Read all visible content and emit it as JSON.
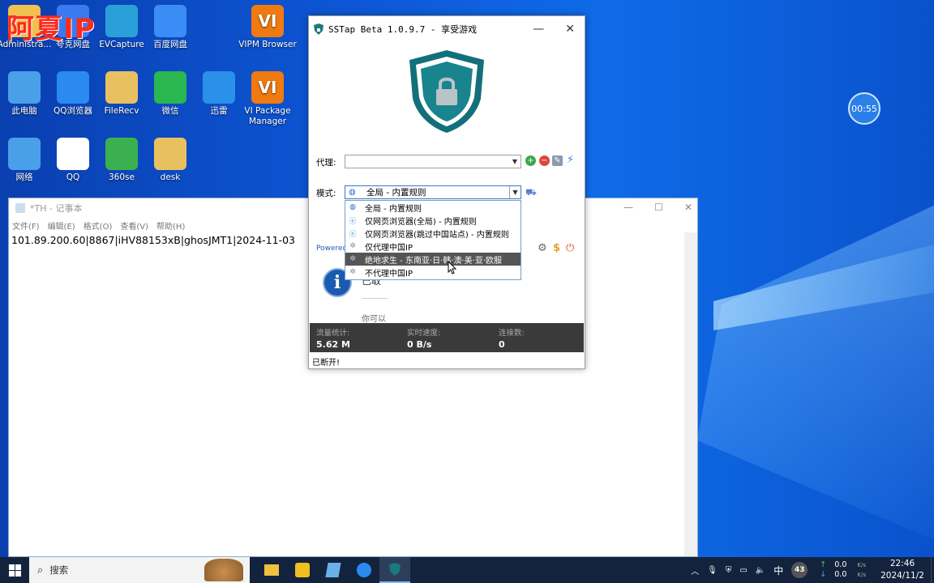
{
  "watermark": "阿夏IP",
  "desktop": {
    "icons": [
      {
        "label": "Administra...",
        "icon": "user-folder-icon",
        "color": "#f0c050"
      },
      {
        "label": "夸克网盘",
        "icon": "quark-icon",
        "color": "#3a7af0"
      },
      {
        "label": "EVCapture",
        "icon": "evcapture-icon",
        "color": "#2aa0d8"
      },
      {
        "label": "百度网盘",
        "icon": "baidu-netdisk-icon",
        "color": "#3b8df5"
      },
      {
        "label": "VIPM Browser",
        "icon": "vipm-icon",
        "color": "#f07a10"
      },
      {
        "label": "此电脑",
        "icon": "this-pc-icon",
        "color": "#4aa0e8"
      },
      {
        "label": "QQ浏览器",
        "icon": "qq-browser-icon",
        "color": "#2a8af0"
      },
      {
        "label": "FileRecv",
        "icon": "folder-icon",
        "color": "#e8c060"
      },
      {
        "label": "微信",
        "icon": "wechat-icon",
        "color": "#2ab650"
      },
      {
        "label": "迅雷",
        "icon": "xunlei-icon",
        "color": "#2a90e8"
      },
      {
        "label": "VI Package Manager",
        "icon": "vi-package-icon",
        "color": "#f07a10"
      },
      {
        "label": "网络",
        "icon": "network-icon",
        "color": "#4aa0e8"
      },
      {
        "label": "QQ",
        "icon": "qq-icon",
        "color": "#ffffff"
      },
      {
        "label": "360se",
        "icon": "360se-icon",
        "color": "#3ab050"
      },
      {
        "label": "desk",
        "icon": "folder-icon",
        "color": "#e8c060"
      }
    ],
    "timer": "00:55"
  },
  "notepad": {
    "title": "*TH - 记事本",
    "menu": [
      "文件(F)",
      "编辑(E)",
      "格式(O)",
      "查看(V)",
      "帮助(H)"
    ],
    "content": "101.89.200.60|8867|iHV88153xB|ghosJMT1|2024-11-03"
  },
  "sstap": {
    "title": "SSTap Beta 1.0.9.7 - 享受游戏",
    "proxy_label": "代理:",
    "proxy_value": "",
    "mode_label": "模式:",
    "mode_value": "全局 - 内置规则",
    "dropdown": [
      {
        "label": "全局 - 内置规则",
        "icon": "globe-icon",
        "selected": false
      },
      {
        "label": "仅网页浏览器(全局) - 内置规则",
        "icon": "ie-icon",
        "selected": false
      },
      {
        "label": "仅网页浏览器(跳过中国站点) - 内置规则",
        "icon": "ie-icon",
        "selected": false
      },
      {
        "label": "仅代理中国IP",
        "icon": "game-icon",
        "selected": false
      },
      {
        "label": "绝地求生 - 东南亚·日·韩·澳·美·亚·欧服",
        "icon": "game-icon",
        "selected": true
      },
      {
        "label": "不代理中国IP",
        "icon": "game-icon",
        "selected": false
      }
    ],
    "powered": "Powered",
    "info_text": "已取",
    "info_sub": "你可以",
    "stats": {
      "traffic_label": "流量统计:",
      "traffic_value": "5.62 M",
      "speed_label": "实时速度:",
      "speed_value": "0 B/s",
      "conn_label": "连接数:",
      "conn_value": "0"
    },
    "status": "已断开!"
  },
  "taskbar": {
    "search_placeholder": "搜索",
    "ime": "中",
    "badge": "43",
    "up_speed": "0.0",
    "down_speed": "0.0",
    "speed_unit": "K/s",
    "time": "22:46",
    "date": "2024/11/2"
  }
}
